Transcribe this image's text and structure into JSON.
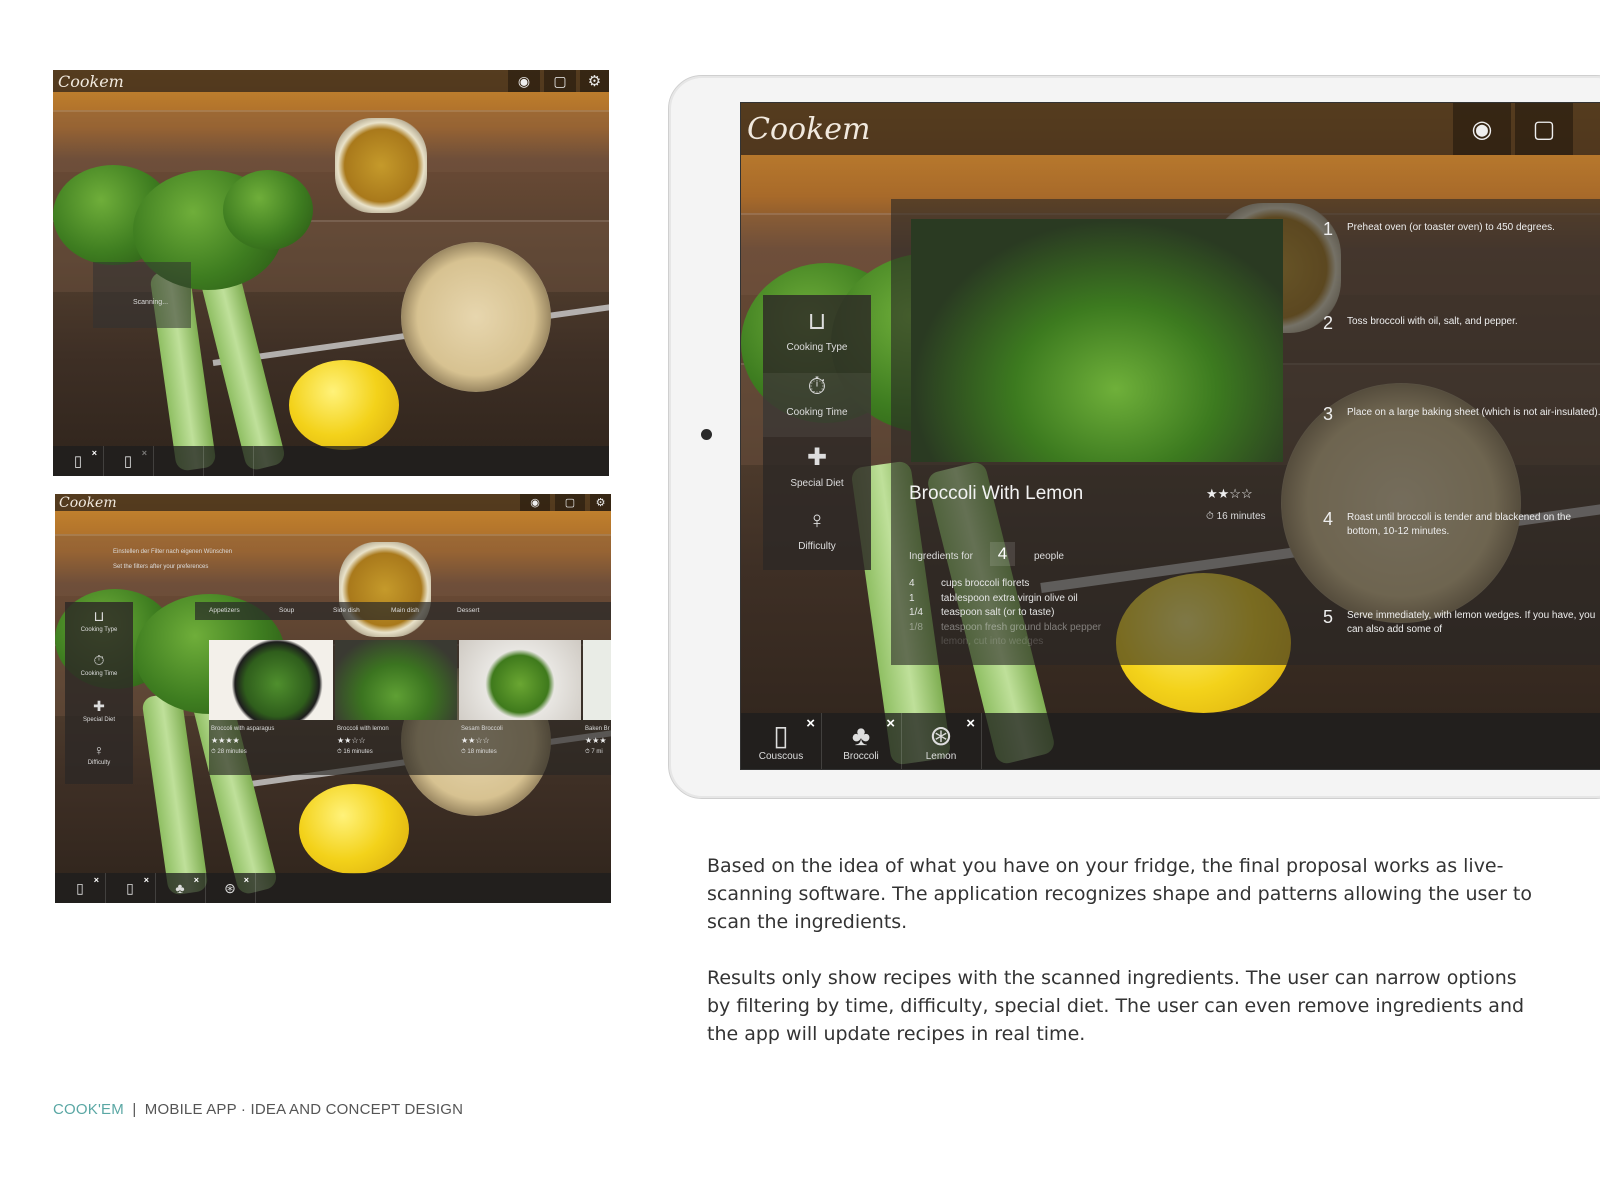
{
  "screen1": {
    "logo": "Cookem",
    "scanning_text": "Scanning..."
  },
  "screen2": {
    "logo": "Cookem",
    "hint_line1": "Einstellen der Filter nach eigenen Wünschen",
    "hint_line2": "Set the filters after your preferences",
    "filters": [
      {
        "label": "Cooking Type",
        "icon": "pot-icon"
      },
      {
        "label": "Cooking Time",
        "icon": "timer-icon"
      },
      {
        "label": "Special Diet",
        "icon": "plus-icon"
      },
      {
        "label": "Difficulty",
        "icon": "chef-icon"
      }
    ],
    "categories": [
      "Appetizers",
      "Soup",
      "Side dish",
      "Main dish",
      "Dessert"
    ],
    "recipes": [
      {
        "name": "Broccoli with asparagus",
        "stars": "★★★★",
        "time": "28 minutes"
      },
      {
        "name": "Broccoli with lemon",
        "stars": "★★☆☆",
        "time": "16 minutes"
      },
      {
        "name": "Sesam Broccoli",
        "stars": "★★☆☆",
        "time": "18 minutes"
      },
      {
        "name": "Baken Br",
        "stars": "★★★",
        "time": "7 mi"
      }
    ]
  },
  "tablet": {
    "logo": "Cookem",
    "filters": [
      {
        "label": "Cooking Type",
        "icon": "pot-icon"
      },
      {
        "label": "Cooking Time",
        "icon": "timer-icon"
      },
      {
        "label": "Special Diet",
        "icon": "plus-icon"
      },
      {
        "label": "Difficulty",
        "icon": "chef-icon"
      }
    ],
    "recipe": {
      "title": "Broccoli With Lemon",
      "stars": "★★☆☆",
      "time": "16 minutes",
      "ingredients_for_label": "Ingredients for",
      "servings": "4",
      "people_label": "people",
      "ingredients": [
        {
          "qty": "4",
          "item": "cups broccoli florets"
        },
        {
          "qty": "1",
          "item": "tablespoon extra virgin olive oil"
        },
        {
          "qty": "1/4",
          "item": "teaspoon salt (or to taste)"
        },
        {
          "qty": "1/8",
          "item": "teaspoon fresh ground black pepper"
        },
        {
          "qty": "",
          "item": "lemon, cut into wedges"
        }
      ],
      "steps": [
        {
          "num": "1",
          "text": "Preheat oven (or toaster oven) to 450 degrees."
        },
        {
          "num": "2",
          "text": "Toss broccoli with oil, salt, and pepper."
        },
        {
          "num": "3",
          "text": "Place on a large baking sheet (which is not air-insulated)."
        },
        {
          "num": "4",
          "text": "Roast until broccoli is tender and blackened on the bottom, 10-12 minutes."
        },
        {
          "num": "5",
          "text": "Serve immediately, with lemon wedges. If you have, you can also add some of"
        }
      ]
    },
    "ingredients_bar": [
      {
        "label": "Couscous",
        "icon": "jar-icon"
      },
      {
        "label": "Broccoli",
        "icon": "broccoli-icon"
      },
      {
        "label": "Lemon",
        "icon": "lemon-icon"
      }
    ]
  },
  "description": {
    "paragraph1": "Based on the idea of what you have on your fridge, the final proposal works as live-scanning software. The application recognizes shape and patterns allowing the user to scan the ingredients.",
    "paragraph2": "Results only show recipes with the scanned ingredients. The user can narrow options by filtering by time, difficulty, special diet.  The user can even remove ingredients and the app will update recipes in real time."
  },
  "footer": {
    "brand": "COOK'EM",
    "separator": "|",
    "subtitle": "MOBILE APP · IDEA AND CONCEPT DESIGN"
  },
  "colors": {
    "brand": "#5aa7a4",
    "footer_text": "#555555"
  }
}
